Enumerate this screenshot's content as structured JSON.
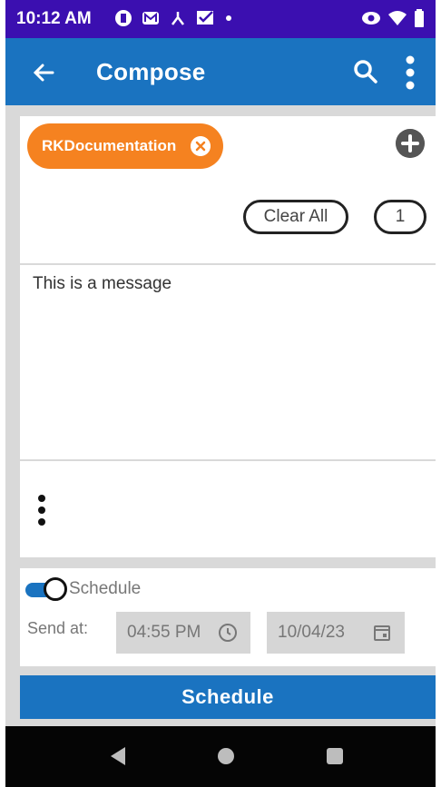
{
  "status_bar": {
    "time": "10:12 AM",
    "left_icons": [
      "circle-badge-icon",
      "mail-m-icon",
      "network-tree-icon",
      "checkbox-message-icon",
      "dot-icon"
    ],
    "right_icons": [
      "eye-icon",
      "wifi-icon",
      "battery-icon"
    ]
  },
  "app_bar": {
    "title": "Compose",
    "color": "#1a73c0"
  },
  "recipients": {
    "chip_label": "RKDocumentation",
    "chip_color": "#f58220",
    "clear_all_label": "Clear All",
    "count": "1"
  },
  "message": {
    "text": "This is a message"
  },
  "schedule": {
    "toggle_on": true,
    "label": "Schedule",
    "send_at_label": "Send at:",
    "time_value": "04:55 PM",
    "date_value": "10/04/23"
  },
  "schedule_button": {
    "label": "Schedule"
  },
  "nav_bar": {
    "buttons": [
      "back-triangle-icon",
      "home-circle-icon",
      "recents-square-icon"
    ]
  }
}
